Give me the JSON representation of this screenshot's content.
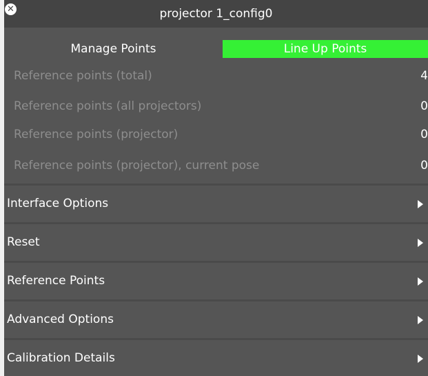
{
  "window": {
    "title": "projector 1_config0",
    "close_glyph": "✕"
  },
  "modes": {
    "manage_label": "Manage Points",
    "lineup_label": "Line Up Points",
    "active": "Line Up Points",
    "active_color": "#35f035"
  },
  "info": [
    {
      "label": "Reference points (total)",
      "value": "4"
    },
    {
      "label": "Reference points (all projectors)",
      "value": "0"
    },
    {
      "label": "Reference points (projector)",
      "value": "0"
    },
    {
      "label": "Reference points (projector), current pose",
      "value": "0"
    }
  ],
  "sections": [
    {
      "label": "Interface Options",
      "icon": "expand-arrow-icon"
    },
    {
      "label": "Reset",
      "icon": "expand-arrow-icon"
    },
    {
      "label": "Reference Points",
      "icon": "expand-arrow-icon"
    },
    {
      "label": "Advanced Options",
      "icon": "expand-arrow-icon"
    },
    {
      "label": "Calibration Details",
      "icon": "expand-arrow-icon"
    }
  ],
  "colors": {
    "panel_bg": "#555555",
    "titlebar_bg": "#444444",
    "muted_text": "#8e8e8e",
    "text": "#ffffff"
  }
}
